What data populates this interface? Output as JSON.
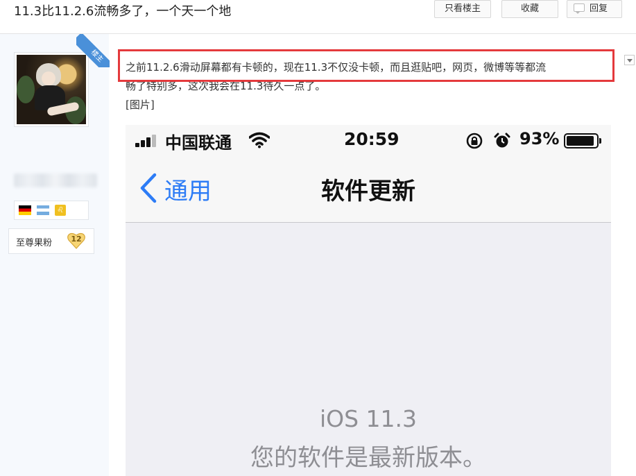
{
  "header": {
    "title": "11.3比11.2.6流畅多了，一个天一个地",
    "only_owner_label": "只看楼主",
    "favorite_label": "收藏",
    "reply_label": "回复"
  },
  "user": {
    "owner_badge": "楼主",
    "rank_title": "至尊果粉",
    "level": "12",
    "medals": [
      "german-flag-icon",
      "argentina-flag-icon",
      "leo-zodiac-icon"
    ]
  },
  "post": {
    "line1": "之前11.2.6滑动屏幕都有卡顿的，现在11.3不仅没卡顿，而且逛贴吧，网页，微博等等都流",
    "line2": "畅了特别多，这次我会在11.3待久一点了。",
    "image_placeholder": "[图片]"
  },
  "phone": {
    "carrier": "中国联通",
    "time": "20:59",
    "battery_percent": "93%",
    "battery_level": 0.93,
    "back_label": "通用",
    "nav_title": "软件更新",
    "ios_version": "iOS 11.3",
    "update_status": "您的软件是最新版本。"
  },
  "colors": {
    "highlight_border": "#e4393c",
    "owner_badge": "#4a90d9",
    "ios_blue": "#2d7cf6",
    "sidebar_bg": "#f6f9fd"
  }
}
